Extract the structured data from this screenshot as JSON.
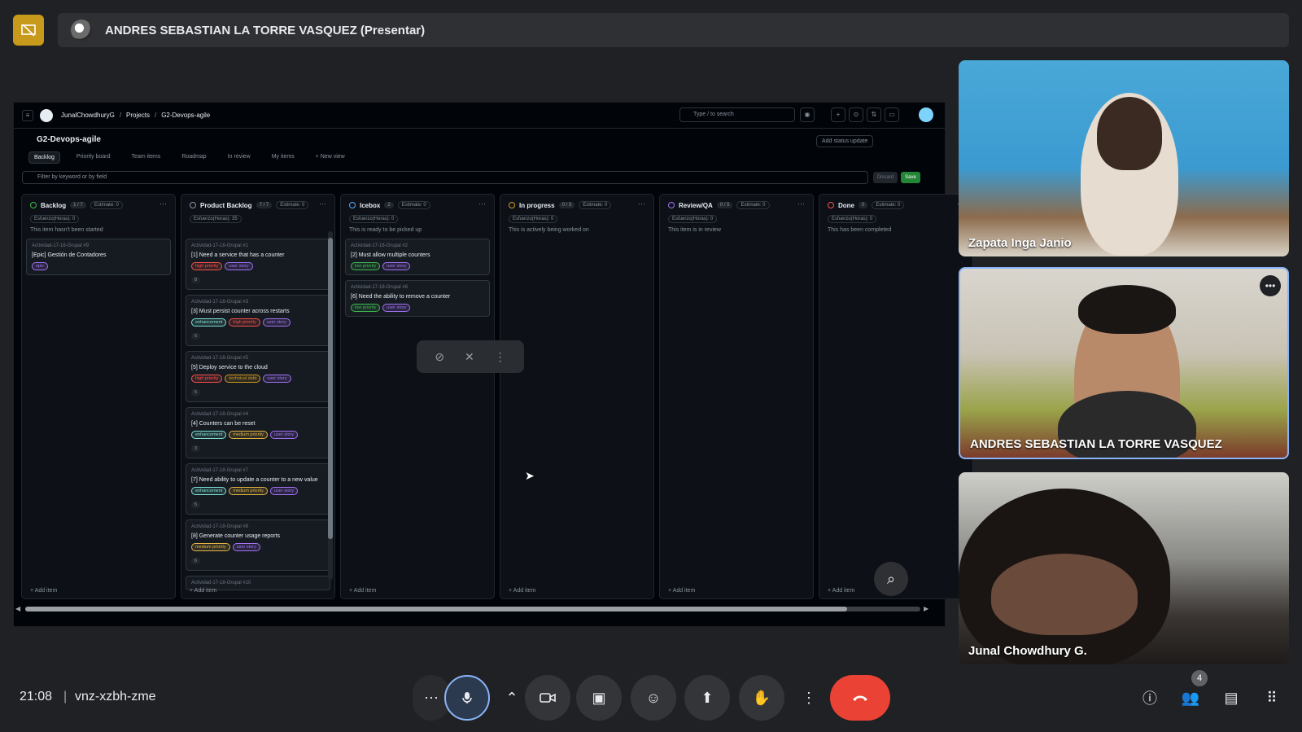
{
  "header": {
    "presenter_title": "ANDRES SEBASTIAN LA TORRE VASQUEZ (Presentar)"
  },
  "github": {
    "breadcrumb": [
      "JunalChowdhuryG",
      "Projects",
      "G2-Devops-agile"
    ],
    "search_placeholder": "Type / to search",
    "project_title": "G2-Devops-agile",
    "status_button": "Add status update",
    "views": [
      "Backlog",
      "Priority board",
      "Team items",
      "Roadmap",
      "In review",
      "My items",
      "+ New view"
    ],
    "filter_placeholder": "Filter by keyword or by field",
    "discard": "Discard",
    "save": "Save",
    "add_item": "+ Add item",
    "columns": [
      {
        "name": "Backlog",
        "count": "1 / 7",
        "estimate": "Estimate: 0",
        "esfuerzo": "Esfuerzo(Horas): 0",
        "desc": "This item hasn't been started",
        "color": "#3fb950",
        "cards": [
          {
            "ref": "Actividad-17-18-Grupal #9",
            "title": "[Epic] Gestión de Contadores",
            "labels": [
              {
                "text": "epic",
                "c": "#a371f7"
              }
            ]
          }
        ]
      },
      {
        "name": "Product Backlog",
        "count": "7 / 7",
        "estimate": "Estimate: 0",
        "esfuerzo": "Esfuerzo(Horas): 35",
        "desc": "",
        "color": "#8b949e",
        "cards": [
          {
            "ref": "Actividad-17-18-Grupal #1",
            "title": "[1] Need a service that has a counter",
            "labels": [
              {
                "text": "high priority",
                "c": "#f85149"
              },
              {
                "text": "user story",
                "c": "#a371f7"
              }
            ],
            "num": "8"
          },
          {
            "ref": "Actividad-17-18-Grupal #3",
            "title": "[3] Must persist counter across restarts",
            "labels": [
              {
                "text": "enhancement",
                "c": "#7ee2d4"
              },
              {
                "text": "high priority",
                "c": "#f85149"
              },
              {
                "text": "user story",
                "c": "#a371f7"
              }
            ],
            "num": "5"
          },
          {
            "ref": "Actividad-17-18-Grupal #5",
            "title": "[5] Deploy service to the cloud",
            "labels": [
              {
                "text": "high priority",
                "c": "#f85149"
              },
              {
                "text": "technical debt",
                "c": "#d29922"
              },
              {
                "text": "user story",
                "c": "#a371f7"
              }
            ],
            "num": "5"
          },
          {
            "ref": "Actividad-17-18-Grupal #4",
            "title": "[4] Counters can be reset",
            "labels": [
              {
                "text": "enhancement",
                "c": "#7ee2d4"
              },
              {
                "text": "medium priority",
                "c": "#e3b341"
              },
              {
                "text": "user story",
                "c": "#a371f7"
              }
            ],
            "num": "3"
          },
          {
            "ref": "Actividad-17-18-Grupal #7",
            "title": "[7] Need ability to update a counter to a new value",
            "labels": [
              {
                "text": "enhancement",
                "c": "#7ee2d4"
              },
              {
                "text": "medium priority",
                "c": "#e3b341"
              },
              {
                "text": "user story",
                "c": "#a371f7"
              }
            ],
            "num": "5"
          },
          {
            "ref": "Actividad-17-18-Grupal #8",
            "title": "[8] Generate counter usage reports",
            "labels": [
              {
                "text": "medium priority",
                "c": "#e3b341"
              },
              {
                "text": "user story",
                "c": "#a371f7"
              }
            ],
            "num": "6"
          },
          {
            "ref": "Actividad-17-18-Grupal #10",
            "title": "",
            "labels": []
          }
        ]
      },
      {
        "name": "Icebox",
        "count": "2",
        "estimate": "Estimate: 0",
        "esfuerzo": "Esfuerzo(Horas): 0",
        "desc": "This is ready to be picked up",
        "color": "#58a6ff",
        "cards": [
          {
            "ref": "Actividad-17-18-Grupal #2",
            "title": "[2] Must allow multiple counters",
            "labels": [
              {
                "text": "low priority",
                "c": "#3fb950"
              },
              {
                "text": "user story",
                "c": "#a371f7"
              }
            ]
          },
          {
            "ref": "Actividad-17-18-Grupal #6",
            "title": "[6] Need the ability to remove a counter",
            "labels": [
              {
                "text": "low priority",
                "c": "#3fb950"
              },
              {
                "text": "user story",
                "c": "#a371f7"
              }
            ]
          }
        ]
      },
      {
        "name": "In progress",
        "count": "0 / 3",
        "estimate": "Estimate: 0",
        "esfuerzo": "Esfuerzo(Horas): 0",
        "desc": "This is actively being worked on",
        "color": "#d29922",
        "cards": []
      },
      {
        "name": "Review/QA",
        "count": "0 / 5",
        "estimate": "Estimate: 0",
        "esfuerzo": "Esfuerzo(Horas): 0",
        "desc": "This item is in review",
        "color": "#a371f7",
        "cards": []
      },
      {
        "name": "Done",
        "count": "0",
        "estimate": "Estimate: 0",
        "esfuerzo": "Esfuerzo(Horas): 0",
        "desc": "This has been completed",
        "color": "#f85149",
        "cards": []
      }
    ]
  },
  "participants": [
    {
      "name": "Zapata Inga Janio"
    },
    {
      "name": "ANDRES SEBASTIAN LA TORRE VASQUEZ"
    },
    {
      "name": "Junal Chowdhury G."
    }
  ],
  "bottom": {
    "time": "21:08",
    "separator": "|",
    "meeting_code": "vnz-xzbh-zme",
    "participant_count": "4"
  },
  "icons": [
    "present-off-icon",
    "more-horiz-icon",
    "mic-icon",
    "chevron-up-icon",
    "camera-icon",
    "captions-icon",
    "emoji-icon",
    "present-icon",
    "hand-icon",
    "more-vert-icon",
    "end-call-icon",
    "info-icon",
    "people-icon",
    "chat-icon",
    "apps-icon",
    "zoom-in-icon"
  ]
}
